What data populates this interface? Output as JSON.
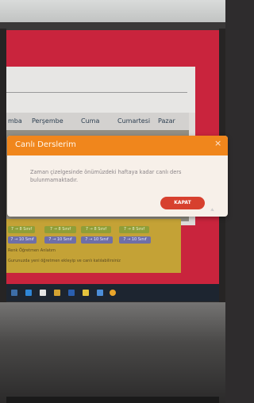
{
  "schedule": {
    "days": [
      "mba",
      "Perşembe",
      "Cuma",
      "Cumartesi",
      "Pazar"
    ],
    "lessons_row1": [
      "7 → 8 Sınıf",
      "7 → 8 Sınıf",
      "7 → 8 Sınıf",
      "7 → 8 Sınıf"
    ],
    "lessons_row2": [
      "7 → 10 Sınıf",
      "7 → 10 Sınıf",
      "7 → 10 Sınıf",
      "7 → 10 Sınıf"
    ],
    "footer_line1": "Renk Öğretmen Anlatım",
    "footer_line2": "Gurunuzda yeni öğretmen ekleyip ve canlı katılabilirsiniz"
  },
  "modal": {
    "title": "Canlı Derslerim",
    "close_glyph": "×",
    "message": "Zaman çizelgesinde önümüzdeki haftaya kadar canlı ders bulunmamaktadır.",
    "button_label": "KAPAT"
  },
  "colors": {
    "modal_header": "#f0861c",
    "close_button": "#d7402e",
    "background_red": "#c9243d"
  }
}
